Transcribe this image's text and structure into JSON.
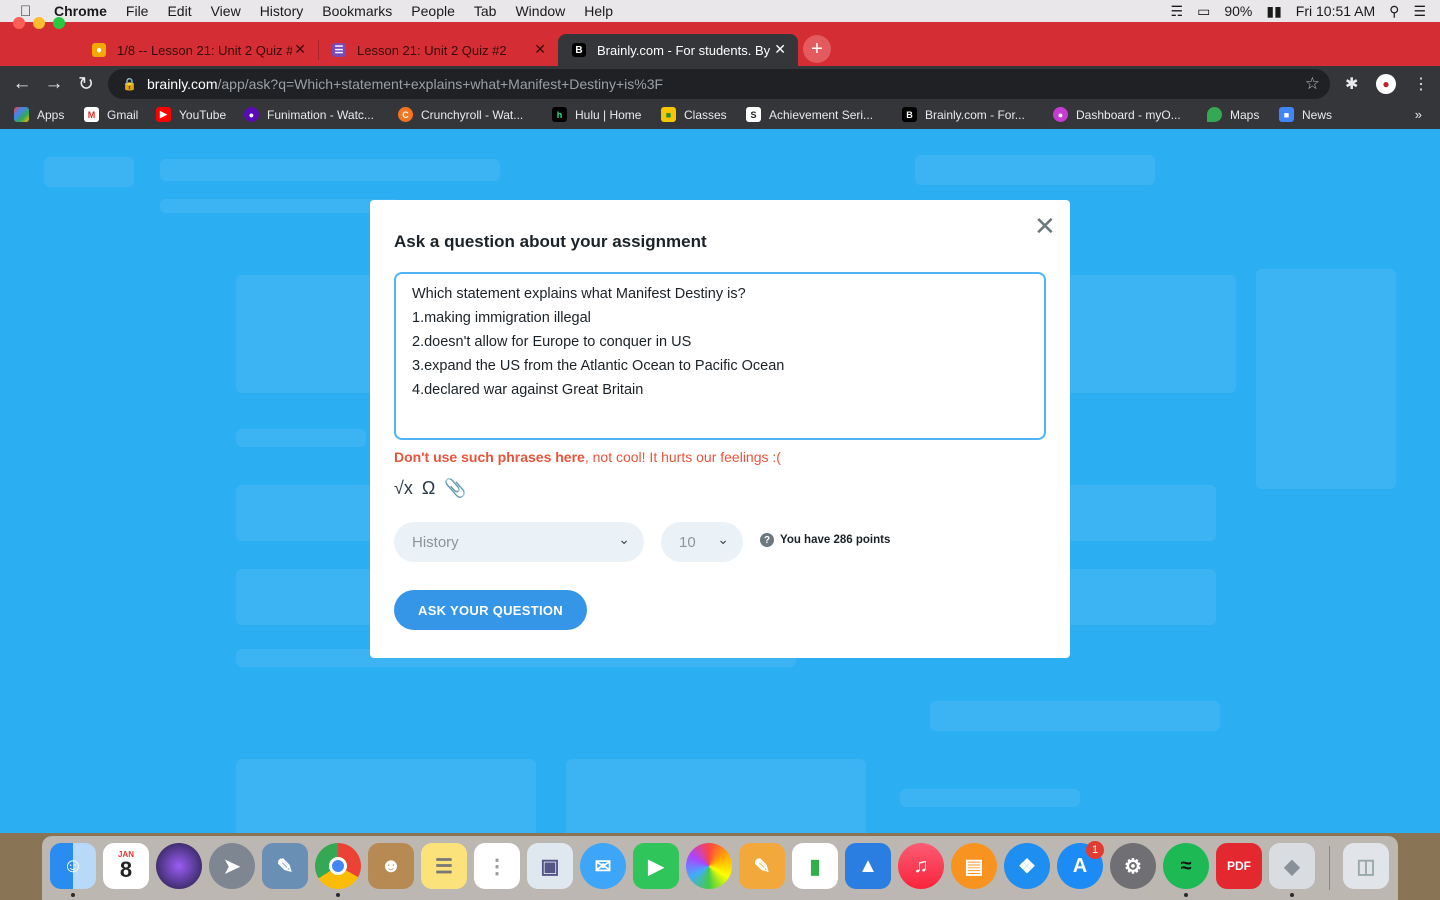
{
  "menubar": {
    "app": "Chrome",
    "items": [
      "File",
      "Edit",
      "View",
      "History",
      "Bookmarks",
      "People",
      "Tab",
      "Window",
      "Help"
    ],
    "battery": "90%",
    "clock": "Fri 10:51 AM"
  },
  "tabs": [
    {
      "label": "1/8 -- Lesson 21: Unit 2 Quiz #",
      "icon": "classroom-icon"
    },
    {
      "label": "Lesson 21: Unit 2 Quiz #2",
      "icon": "forms-icon"
    },
    {
      "label": "Brainly.com - For students. By",
      "icon": "brainly-icon"
    }
  ],
  "address": {
    "host": "brainly.com",
    "path": "/app/ask?q=Which+statement+explains+what+Manifest+Destiny+is%3F"
  },
  "bookmarks": [
    "Apps",
    "Gmail",
    "YouTube",
    "Funimation - Watc...",
    "Crunchyroll - Wat...",
    "Hulu | Home",
    "Classes",
    "Achievement Seri...",
    "Brainly.com - For...",
    "Dashboard - myO...",
    "Maps",
    "News"
  ],
  "modal": {
    "title": "Ask a question about your assignment",
    "question_lines": [
      "Which statement explains what Manifest Destiny is?",
      "1.making immigration illegal",
      "2.doesn't allow for Europe to conquer in US",
      "3.expand the US from the Atlantic Ocean to Pacific Ocean",
      "4.declared war against Great Britain"
    ],
    "warning_bold": "Don't use such phrases here",
    "warning_rest": ", not cool! It hurts our feelings :(",
    "subject": "History",
    "points_value": "10",
    "points_info": "You have 286 points",
    "submit_label": "ASK YOUR QUESTION"
  },
  "dock": {
    "calendar_month": "JAN",
    "calendar_day": "8",
    "appstore_badge": "1"
  },
  "colors": {
    "page_bg": "#2caef2",
    "tabstrip": "#d42e34",
    "button": "#3596e8",
    "warning": "#e8543c"
  }
}
